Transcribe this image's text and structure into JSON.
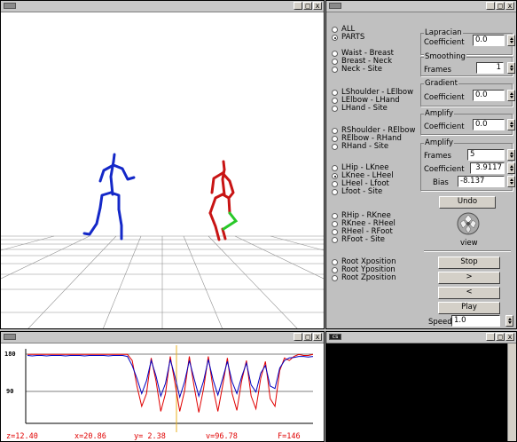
{
  "viewer": {
    "buttons": [
      "_",
      "□",
      "x"
    ]
  },
  "control_panel": {
    "buttons_tb": [
      "_",
      "□",
      "x"
    ],
    "mode": [
      {
        "label": "ALL",
        "checked": false
      },
      {
        "label": "PARTS",
        "checked": true
      }
    ],
    "parts": [
      {
        "label": "Waist - Breast",
        "checked": false
      },
      {
        "label": "Breast - Neck",
        "checked": false
      },
      {
        "label": "Neck - Site",
        "checked": false
      },
      {
        "label": "LShoulder - LElbow",
        "checked": false
      },
      {
        "label": "LElbow - LHand",
        "checked": false
      },
      {
        "label": "LHand - Site",
        "checked": false
      },
      {
        "label": "RShoulder - RElbow",
        "checked": false
      },
      {
        "label": "RElbow - RHand",
        "checked": false
      },
      {
        "label": "RHand - Site",
        "checked": false
      },
      {
        "label": "LHip - LKnee",
        "checked": false
      },
      {
        "label": "LKnee - LHeel",
        "checked": true
      },
      {
        "label": "LHeel - Lfoot",
        "checked": false
      },
      {
        "label": "Lfoot - Site",
        "checked": false
      },
      {
        "label": "RHip - RKnee",
        "checked": false
      },
      {
        "label": "RKnee - RHeel",
        "checked": false
      },
      {
        "label": "RHeel - RFoot",
        "checked": false
      },
      {
        "label": "RFoot - Site",
        "checked": false
      },
      {
        "label": "Root Xposition",
        "checked": false
      },
      {
        "label": "Root Yposition",
        "checked": false
      },
      {
        "label": "Root Zposition",
        "checked": false
      }
    ],
    "laplacian": {
      "title": "Lapracian",
      "coef_label": "Coefficient",
      "coef": "0.0"
    },
    "smoothing": {
      "title": "Smoothing",
      "frames_label": "Frames",
      "frames": "1"
    },
    "gradient": {
      "title": "Gradient",
      "coef_label": "Coefficient",
      "coef": "0.0"
    },
    "amplify1": {
      "title": "Amplify",
      "coef_label": "Coefficient",
      "coef": "0.0"
    },
    "amplify2": {
      "title": "Amplify",
      "frames_label": "Frames",
      "frames": "5",
      "coef_label": "Coefficient",
      "coef": "3.9117",
      "bias_label": "Bias",
      "bias": "-8.137"
    },
    "undo": "Undo",
    "view": "view",
    "stop": "Stop",
    "forward": ">",
    "back": "<",
    "play": "Play",
    "speed_label": "Speed",
    "speed": "1.0"
  },
  "graph": {
    "buttons": [
      "_",
      "□",
      "x"
    ],
    "y_top": "180",
    "y_mid": "90",
    "readouts": {
      "z": "z=12.40",
      "x": "x=20.86",
      "y": "y=  2.38",
      "v": "v=96.78",
      "f": "F=146"
    }
  },
  "console": {
    "title": "cs",
    "buttons": [
      "_",
      "□",
      "x"
    ]
  },
  "chart_data": {
    "type": "line",
    "title": "",
    "xlabel": "",
    "ylabel": "",
    "ylim": [
      40,
      190
    ],
    "x": [
      0,
      5,
      10,
      15,
      20,
      25,
      30,
      35,
      40,
      45,
      50,
      55,
      60,
      65,
      70,
      75,
      80,
      85,
      90,
      95,
      100,
      105,
      110,
      115,
      120,
      125,
      130,
      135,
      140,
      145,
      150,
      155,
      160,
      165,
      170,
      175,
      180,
      185,
      190,
      195,
      200,
      205,
      210,
      215,
      220,
      225,
      230,
      235,
      240,
      245,
      250,
      255,
      260,
      265,
      270,
      275,
      280,
      285,
      290,
      295,
      300
    ],
    "series": [
      {
        "color": "#e00000",
        "values": [
          172,
          172,
          172,
          172,
          172,
          172,
          172,
          172,
          172,
          172,
          172,
          172,
          172,
          172,
          172,
          172,
          172,
          172,
          172,
          172,
          172,
          172,
          160,
          110,
          70,
          95,
          165,
          120,
          60,
          95,
          168,
          115,
          60,
          100,
          168,
          110,
          58,
          105,
          168,
          105,
          60,
          110,
          165,
          95,
          62,
          120,
          160,
          90,
          65,
          125,
          158,
          85,
          70,
          140,
          165,
          160,
          168,
          172,
          170,
          170,
          172
        ]
      },
      {
        "color": "#0000c0",
        "values": [
          170,
          169,
          170,
          170,
          169,
          170,
          170,
          170,
          169,
          170,
          170,
          170,
          169,
          170,
          170,
          170,
          170,
          169,
          170,
          170,
          170,
          168,
          150,
          125,
          95,
          120,
          160,
          130,
          90,
          115,
          162,
          128,
          88,
          118,
          160,
          125,
          90,
          120,
          162,
          122,
          92,
          124,
          158,
          118,
          95,
          128,
          155,
          112,
          98,
          135,
          150,
          110,
          105,
          145,
          160,
          165,
          166,
          168,
          168,
          167,
          168
        ]
      }
    ]
  }
}
